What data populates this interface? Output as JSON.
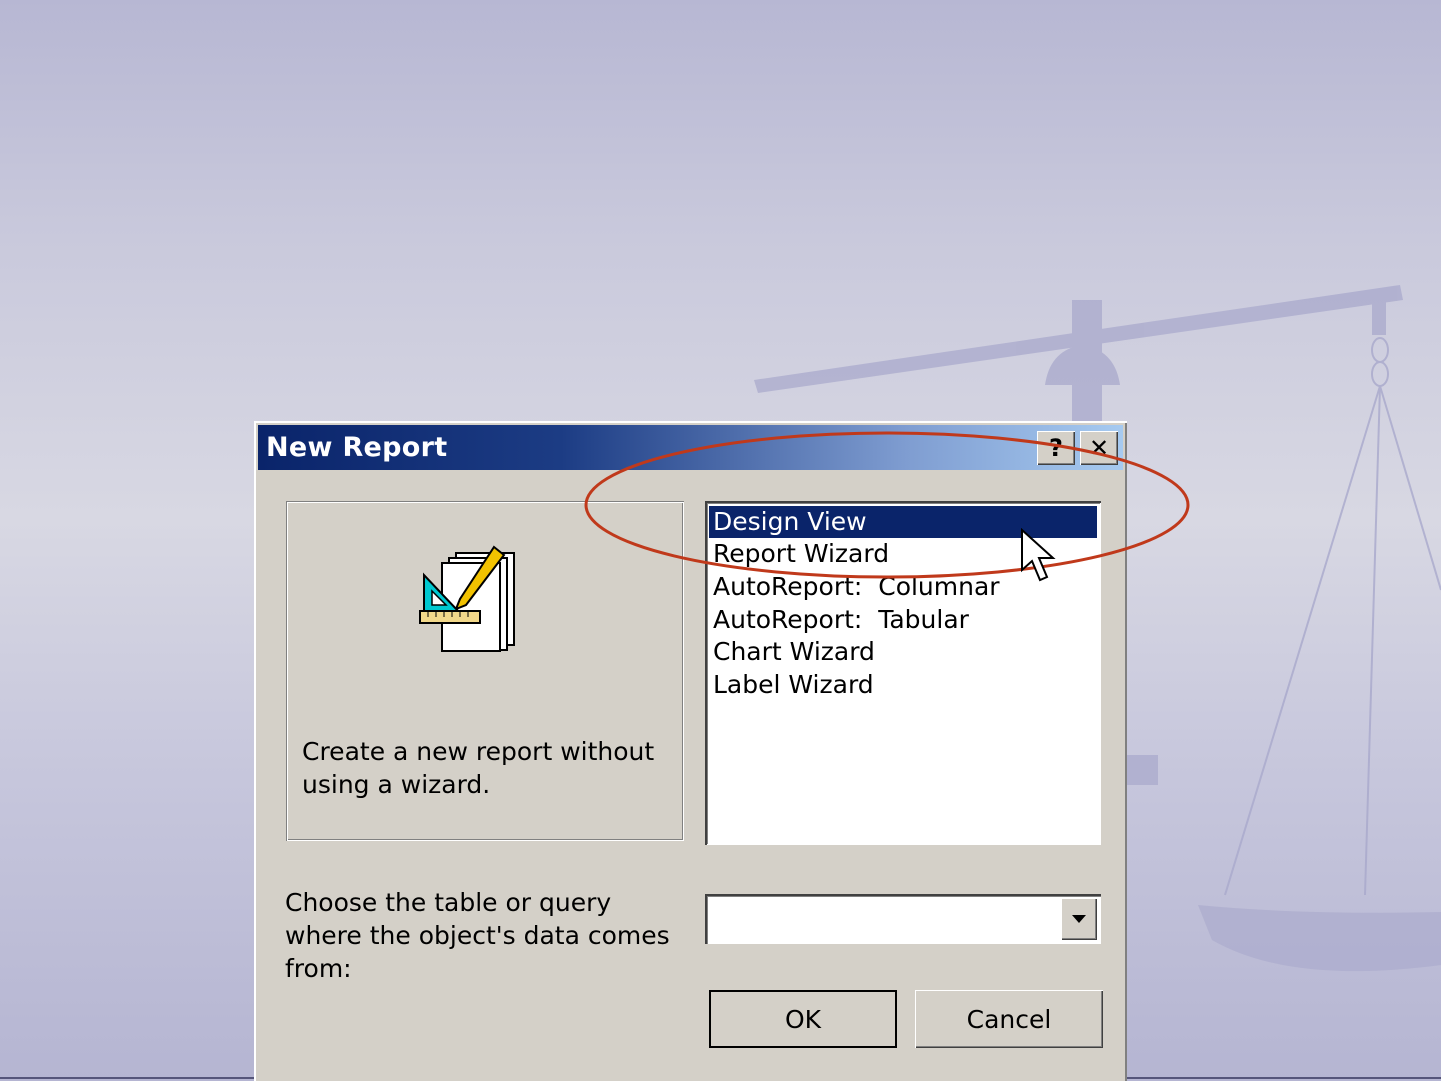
{
  "dialog": {
    "title": "New Report",
    "help_button": "?",
    "close_button": "✕",
    "preview_description": "Create a new report without using a wizard.",
    "report_types": [
      "Design View",
      "Report Wizard",
      "AutoReport:  Columnar",
      "AutoReport:  Tabular",
      "Chart Wizard",
      "Label Wizard"
    ],
    "selected_index": 0,
    "source_label": "Choose the table or query where the object's data comes from:",
    "source_value": "",
    "ok_label": "OK",
    "cancel_label": "Cancel"
  },
  "colors": {
    "selection": "#0a246a",
    "annotation_circle": "#c0391b",
    "dialog_face": "#d4d0c8"
  },
  "icons": {
    "preview": "design-report-icon",
    "dropdown": "chevron-down-icon",
    "cursor": "mouse-pointer-icon"
  }
}
